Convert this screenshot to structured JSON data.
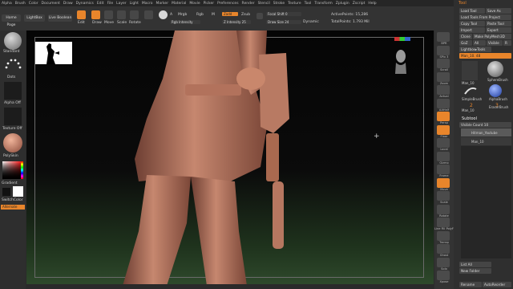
{
  "menu": [
    "Alpha",
    "Brush",
    "Color",
    "Document",
    "Draw",
    "Dynamics",
    "Edit",
    "File",
    "Layer",
    "Light",
    "Macro",
    "Marker",
    "Material",
    "Movie",
    "Picker",
    "Preferences",
    "Render",
    "Stencil",
    "Stroke",
    "Texture",
    "Tool",
    "Transform",
    "Zplugin",
    "Zscript",
    "Help"
  ],
  "toolbar": {
    "home_page": "Home Page",
    "lightbox": "LightBox",
    "live_boolean": "Live Boolean",
    "edit": "Edit",
    "draw": "Draw",
    "move": "Move",
    "scale": "Scale",
    "rotate": "Rotate",
    "a": "A",
    "mrgb": "Mrgb",
    "rgb": "Rgb",
    "m": "M",
    "zadd": "Zadd",
    "zsub": "Zsub",
    "rgb_intensity": "Rgb Intensity",
    "z_intensity": "Z Intensity 25",
    "focal_shift": "Focal Shift 0",
    "draw_size": "Draw Size 24",
    "dynamic": "Dynamic",
    "active_points": "ActivePoints: 15,286",
    "total_points": "TotalPoints: 1.793 Mil"
  },
  "left_shelf": {
    "standard": "Standard",
    "dots": "Dots",
    "alpha_off": "Alpha Off",
    "texture_off": "Texture Off",
    "polyskin": "PolySkin",
    "gradient": "Gradient",
    "switch_color": "SwitchColor",
    "alternate": "Alternate"
  },
  "right_shelf": [
    "BPR",
    "SPix 3",
    "Scroll",
    "Zoom",
    "Actual",
    "AAHalf",
    "Persp",
    "Floor",
    "Local",
    "Gizmo",
    "Frame",
    "Move",
    "Scale",
    "Rotate",
    "Line Fill PolyF",
    "Transp",
    "Ghost",
    "Solo",
    "Xpose"
  ],
  "tool_panel": {
    "title": "Tool",
    "load_tool": "Load Tool",
    "save_as": "Save As",
    "load_from_project": "Load Tools From Project",
    "copy_tool": "Copy Tool",
    "paste_tool": "Paste Tool",
    "import": "Import",
    "export": "Export",
    "clone": "Clone",
    "make_polymesh": "Make PolyMesh3D",
    "goz": "GoZ",
    "all": "All",
    "visible": "Visible",
    "r": "R",
    "lightbox_tools": "Lightbox▸Tools",
    "current_tool": "Man_10. 48",
    "tools": [
      "Man_10",
      "SphereBrush",
      "AlphaBrush",
      "SimpleBrush",
      "EraserBrush",
      "Man_10"
    ],
    "counts": [
      "2",
      "3"
    ],
    "subtool": "Subtool",
    "visible_count": "Visible Count 10",
    "subtools": [
      "Hitman_Youtube",
      "Man_10"
    ],
    "list_all": "List All",
    "new_folder": "New Folder",
    "rename": "Rename",
    "auto_reorder": "AutoReorder"
  },
  "colors": {
    "accent": "#e8852b",
    "panel": "#2f2f2f",
    "button": "#454545"
  }
}
